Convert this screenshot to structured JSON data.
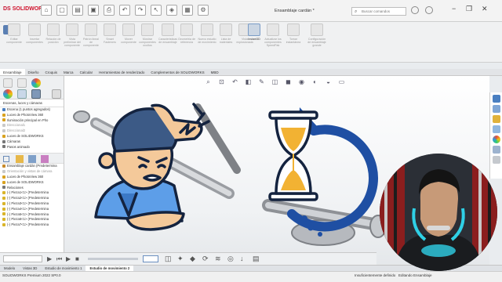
{
  "app": {
    "brand": "SOLIDWORKS",
    "brand_mark": "DS",
    "window_title": "Ensamblaje cardán *",
    "search_placeholder": "Buscar comandos"
  },
  "command_manager": {
    "items": [
      {
        "label": "Editar componente"
      },
      {
        "label": "Insertar componentes"
      },
      {
        "label": "Relación de posición"
      },
      {
        "label": "Vista preliminar del componente"
      },
      {
        "label": "Patrón lineal de componente"
      },
      {
        "label": "Smart Fasteners"
      },
      {
        "label": "Mover componente"
      },
      {
        "label": "Mostrar componentes ocultos"
      },
      {
        "label": "Características de ensamblaje"
      },
      {
        "label": "Geometría de referencia"
      },
      {
        "label": "Nuevo estudio de movimiento"
      },
      {
        "label": "Lista de materiales"
      },
      {
        "label": "Vista explosionada"
      },
      {
        "label": "Instant3D"
      },
      {
        "label": "Actualizar los componentes SpeedPak"
      },
      {
        "label": "Tomar instantánea"
      },
      {
        "label": "Configuración de ensamblaje grande"
      }
    ],
    "active_label": "Instant3D"
  },
  "tabs": [
    "Ensamblaje",
    "Diseño",
    "Croquis",
    "Marca",
    "Calcular",
    "Herramientas de renderizado",
    "Complementos de SOLIDWORKS",
    "MBD"
  ],
  "active_tab": "Ensamblaje",
  "panel": {
    "section_label": "Escenas, luces y cámaras",
    "tree": [
      {
        "text": "Escena (1 puntos agregados)",
        "dim": false,
        "color": "#4a7fc1"
      },
      {
        "text": "Luces de PhotoView 360",
        "dim": false,
        "color": "#d9a21f"
      },
      {
        "text": "Iluminación principal en Pho",
        "dim": false,
        "color": "#d9a21f"
      },
      {
        "text": "Direccional1",
        "dim": true,
        "color": "#c9c9c9"
      },
      {
        "text": "Direccional2",
        "dim": true,
        "color": "#c9c9c9"
      },
      {
        "text": "Luces de SOLIDWORKS",
        "dim": false,
        "color": "#d9a21f"
      },
      {
        "text": "Cámaras",
        "dim": false,
        "color": "#777777"
      },
      {
        "text": "Pasos animado",
        "dim": false,
        "color": "#777777"
      }
    ],
    "tree2": [
      {
        "text": "Ensamblaje cardán (Predetermina",
        "dim": false,
        "color": "#c88a2a"
      },
      {
        "text": "Orientación y vistas de cámara",
        "dim": true,
        "color": "#c9c9c9"
      },
      {
        "text": "Luces de PhotoView 360",
        "dim": false,
        "color": "#d9a21f"
      },
      {
        "text": "Luces de SOLIDWORKS",
        "dim": false,
        "color": "#d9a21f"
      },
      {
        "text": "Relaciones",
        "dim": false,
        "color": "#777777"
      },
      {
        "text": "(-) Pieza1<1> (Predetermina",
        "dim": false,
        "color": "#d9b42a"
      },
      {
        "text": "(-) Pieza2<1> (Predetermina",
        "dim": false,
        "color": "#d9b42a"
      },
      {
        "text": "(-) Pieza3<1> (Predetermina",
        "dim": false,
        "color": "#d9b42a"
      },
      {
        "text": "(-) Pieza4<1> (Predetermina",
        "dim": false,
        "color": "#d9b42a"
      },
      {
        "text": "(-) Pieza5<1> (Predetermina",
        "dim": false,
        "color": "#d9b42a"
      },
      {
        "text": "(-) Pieza6<1> (Predetermina",
        "dim": false,
        "color": "#d9b42a"
      },
      {
        "text": "(-) Pieza7<1> (Predetermina",
        "dim": false,
        "color": "#d9b42a"
      }
    ]
  },
  "bottom_tabs": [
    "Modelo",
    "Vistas 3D",
    "Estudio de movimiento 1",
    "Estudio de movimiento 2"
  ],
  "active_bottom_tab": "Estudio de movimiento 2",
  "status": {
    "left": "SOLIDWORKS Premium 2022 SP0.0",
    "middle": "Insuficientemente definido",
    "right": "Editando Ensamblaje"
  },
  "colors": {
    "accent": "#1f4fa3",
    "hourglass_sand": "#f2b233",
    "frustrated_skin": "#f4c99a",
    "shirt_blue": "#5d9ee8"
  }
}
